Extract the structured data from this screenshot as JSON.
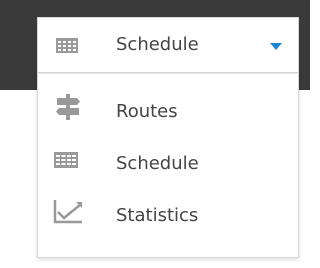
{
  "select": {
    "selected_label": "Schedule",
    "selected_icon": "calendar-grid-icon",
    "caret_icon": "caret-down-icon",
    "accent_color": "#1e86d0"
  },
  "menu": {
    "items": [
      {
        "label": "Routes",
        "icon": "signpost-icon"
      },
      {
        "label": "Schedule",
        "icon": "calendar-grid-icon"
      },
      {
        "label": "Statistics",
        "icon": "line-chart-icon"
      }
    ]
  },
  "colors": {
    "topbar": "#3a3a3a",
    "icon_gray": "#999999",
    "text": "#444444"
  }
}
